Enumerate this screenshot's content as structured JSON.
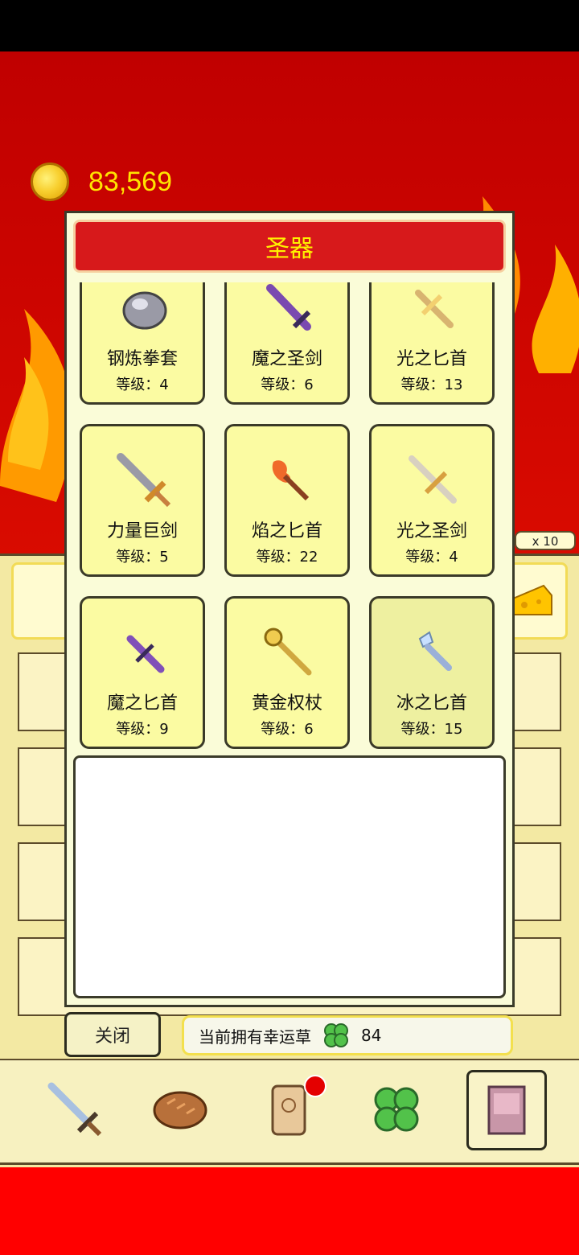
{
  "currency": {
    "amount": "83,569",
    "icon": "gold-coin-icon"
  },
  "inventory": {
    "multiplier_label": "x 10"
  },
  "modal": {
    "title": "圣器",
    "items": [
      {
        "name": "钢炼拳套",
        "level": "等级：4",
        "icon": "steel-gauntlet-icon"
      },
      {
        "name": "魔之圣剑",
        "level": "等级：6",
        "icon": "demon-holy-sword-icon"
      },
      {
        "name": "光之匕首",
        "level": "等级：13",
        "icon": "light-dagger-icon"
      },
      {
        "name": "力量巨剑",
        "level": "等级：5",
        "icon": "power-greatsword-icon"
      },
      {
        "name": "焰之匕首",
        "level": "等级：22",
        "icon": "flame-dagger-icon"
      },
      {
        "name": "光之圣剑",
        "level": "等级：4",
        "icon": "light-holy-sword-icon"
      },
      {
        "name": "魔之匕首",
        "level": "等级：9",
        "icon": "demon-dagger-icon"
      },
      {
        "name": "黄金权杖",
        "level": "等级：6",
        "icon": "golden-scepter-icon"
      },
      {
        "name": "冰之匕首",
        "level": "等级：15",
        "icon": "ice-dagger-icon"
      }
    ],
    "close_label": "关闭",
    "clover": {
      "label": "当前拥有幸运草",
      "count": "84",
      "icon": "four-leaf-clover-icon"
    }
  },
  "bottom_nav": [
    {
      "icon": "sword-icon"
    },
    {
      "icon": "bread-icon"
    },
    {
      "icon": "scroll-icon",
      "badge": true
    },
    {
      "icon": "clover-icon"
    },
    {
      "icon": "book-icon",
      "active": true
    }
  ],
  "colors": {
    "title_bar": "#d7191b",
    "title_text": "#fff200",
    "card_bg": "#fbfba2",
    "coin_text": "#ffe400"
  }
}
